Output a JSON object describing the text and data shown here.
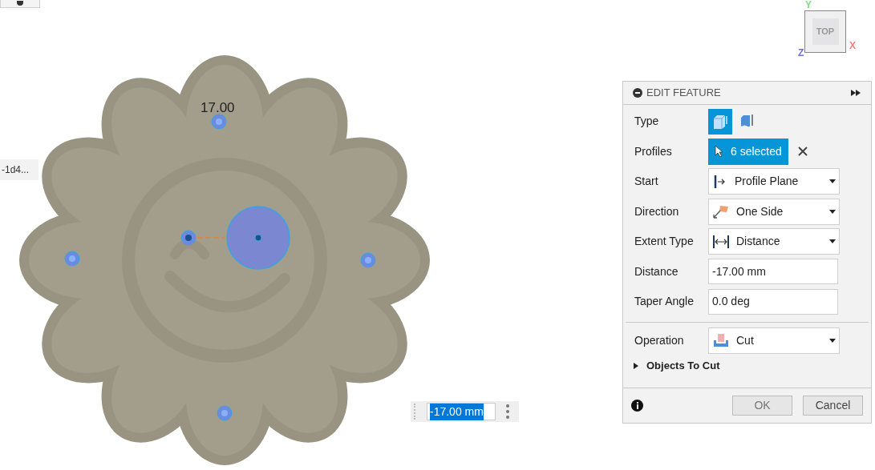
{
  "viewcube": {
    "face": "TOP",
    "axes": [
      {
        "label": "Y",
        "color": "#7ddc7d"
      },
      {
        "label": "X",
        "color": "#f08080"
      },
      {
        "label": "Z",
        "color": "#6b6bf0"
      }
    ]
  },
  "canvas": {
    "dimension": "17.00",
    "tag": "-1d4...",
    "distance_input": "-17.00 mm"
  },
  "panel": {
    "title": "EDIT FEATURE",
    "rows": [
      {
        "kind": "type",
        "label": "Type",
        "options": [
          {
            "selected": true
          },
          {
            "selected": false
          }
        ]
      },
      {
        "kind": "selection",
        "label": "Profiles",
        "value": "6 selected"
      },
      {
        "kind": "dropdown",
        "label": "Start",
        "value": "Profile Plane"
      },
      {
        "kind": "dropdown",
        "label": "Direction",
        "value": "One Side"
      },
      {
        "kind": "dropdown",
        "label": "Extent Type",
        "value": "Distance"
      },
      {
        "kind": "input",
        "label": "Distance",
        "value": "-17.00 mm"
      },
      {
        "kind": "input",
        "label": "Taper Angle",
        "value": "0.0 deg"
      }
    ],
    "operation": {
      "label": "Operation",
      "value": "Cut"
    },
    "section": {
      "label": "Objects To Cut",
      "expanded": false
    },
    "buttons": [
      "OK",
      "Cancel"
    ]
  }
}
